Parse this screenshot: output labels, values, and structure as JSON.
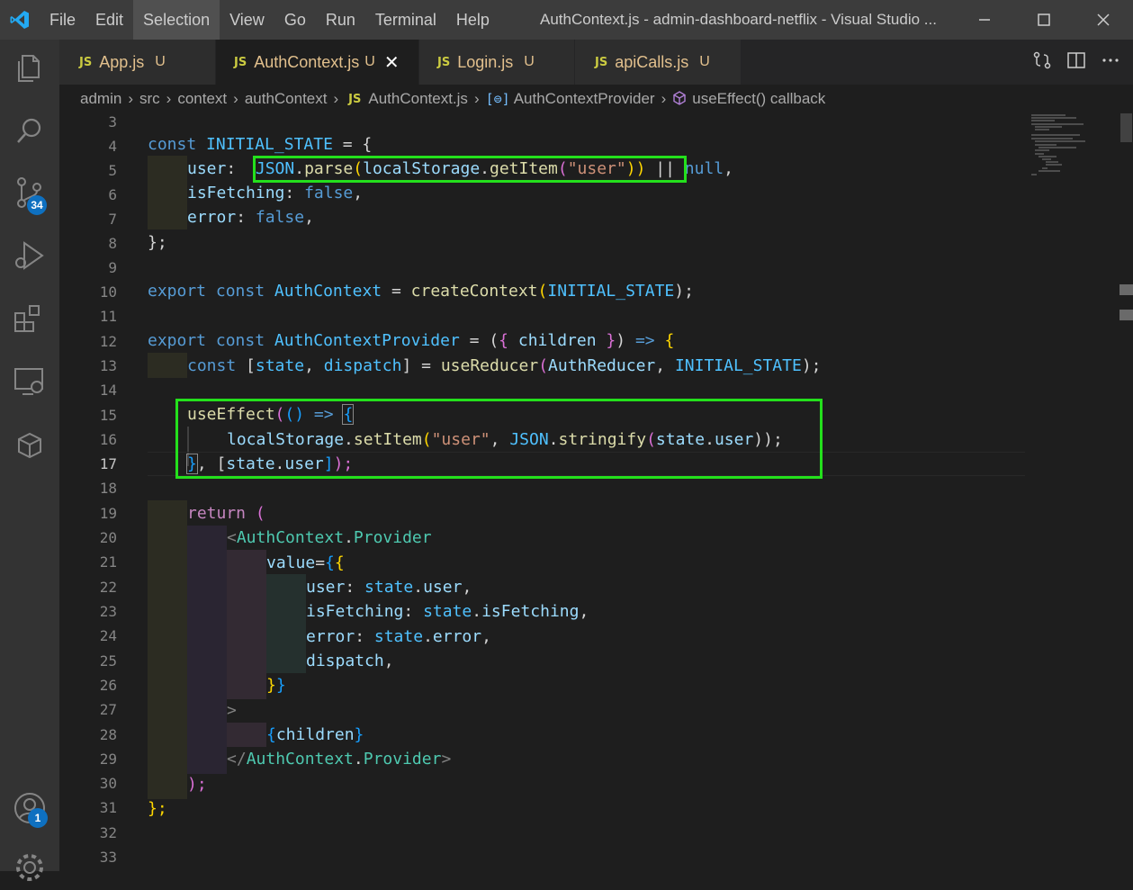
{
  "menu": [
    "File",
    "Edit",
    "Selection",
    "View",
    "Go",
    "Run",
    "Terminal",
    "Help"
  ],
  "window_title": "AuthContext.js - admin-dashboard-netflix - Visual Studio ...",
  "activity_badges": {
    "source_control": "34",
    "accounts": "1"
  },
  "tabs": [
    {
      "badge": "JS",
      "label": "App.js",
      "status": "U"
    },
    {
      "badge": "JS",
      "label": "AuthContext.js",
      "status": "U"
    },
    {
      "badge": "JS",
      "label": "Login.js",
      "status": "U"
    },
    {
      "badge": "JS",
      "label": "apiCalls.js",
      "status": "U"
    }
  ],
  "breadcrumb": [
    "admin",
    "src",
    "context",
    "authContext",
    "AuthContext.js",
    "AuthContextProvider",
    "useEffect() callback"
  ],
  "line_numbers": [
    "3",
    "4",
    "5",
    "6",
    "7",
    "8",
    "9",
    "10",
    "11",
    "12",
    "13",
    "14",
    "15",
    "16",
    "17",
    "18",
    "19",
    "20",
    "21",
    "22",
    "23",
    "24",
    "25",
    "26",
    "27",
    "28",
    "29",
    "30",
    "31",
    "32",
    "33"
  ],
  "current_line": "17",
  "code": {
    "l4": [
      "const",
      "INITIAL_STATE",
      " = {"
    ],
    "l5": [
      "user",
      ":  ",
      "JSON",
      ".",
      "parse",
      "(",
      "localStorage",
      ".",
      "getItem",
      "(",
      "\"user\"",
      "))",
      " || ",
      "null",
      ","
    ],
    "l6": [
      "isFetching",
      ": ",
      "false",
      ","
    ],
    "l7": [
      "error",
      ": ",
      "false",
      ","
    ],
    "l8": [
      "};"
    ],
    "l10": [
      "export",
      " ",
      "const",
      " ",
      "AuthContext",
      " = ",
      "createContext",
      "(",
      "INITIAL_STATE",
      ");"
    ],
    "l12": [
      "export",
      " ",
      "const",
      " ",
      "AuthContextProvider",
      " = (",
      "{",
      " ",
      "children",
      " ",
      "}",
      ") ",
      "=>",
      " ",
      "{"
    ],
    "l13": [
      "const",
      " [",
      "state",
      ", ",
      "dispatch",
      "] = ",
      "useReducer",
      "(",
      "AuthReducer",
      ", ",
      "INITIAL_STATE",
      ");"
    ],
    "l15": [
      "useEffect",
      "(",
      "()",
      " ",
      "=>",
      " ",
      "{"
    ],
    "l16": [
      "localStorage",
      ".",
      "setItem",
      "(",
      "\"user\"",
      ", ",
      "JSON",
      ".",
      "stringify",
      "(",
      "state",
      ".",
      "user",
      "));"
    ],
    "l17": [
      "}",
      ", [",
      "state",
      ".",
      "user",
      "]",
      ");"
    ],
    "l19": [
      "return",
      " ("
    ],
    "l20": [
      "<",
      "AuthContext",
      ".",
      "Provider"
    ],
    "l21": [
      "value",
      "=",
      "{",
      "{"
    ],
    "l22": [
      "user",
      ": ",
      "state",
      ".",
      "user",
      ","
    ],
    "l23": [
      "isFetching",
      ": ",
      "state",
      ".",
      "isFetching",
      ","
    ],
    "l24": [
      "error",
      ": ",
      "state",
      ".",
      "error",
      ","
    ],
    "l25": [
      "dispatch",
      ","
    ],
    "l26": [
      "}",
      "}"
    ],
    "l27": [
      ">"
    ],
    "l28": [
      "{",
      "children",
      "}"
    ],
    "l29": [
      "</",
      "AuthContext",
      ".",
      "Provider",
      ">"
    ],
    "l30": [
      ");"
    ],
    "l31": [
      "};"
    ]
  },
  "colors": {
    "highlight_box": "#24e01c",
    "keyword": "#569cd6",
    "function": "#dcdcaa",
    "string": "#ce9178",
    "variable": "#9cdcfe"
  }
}
